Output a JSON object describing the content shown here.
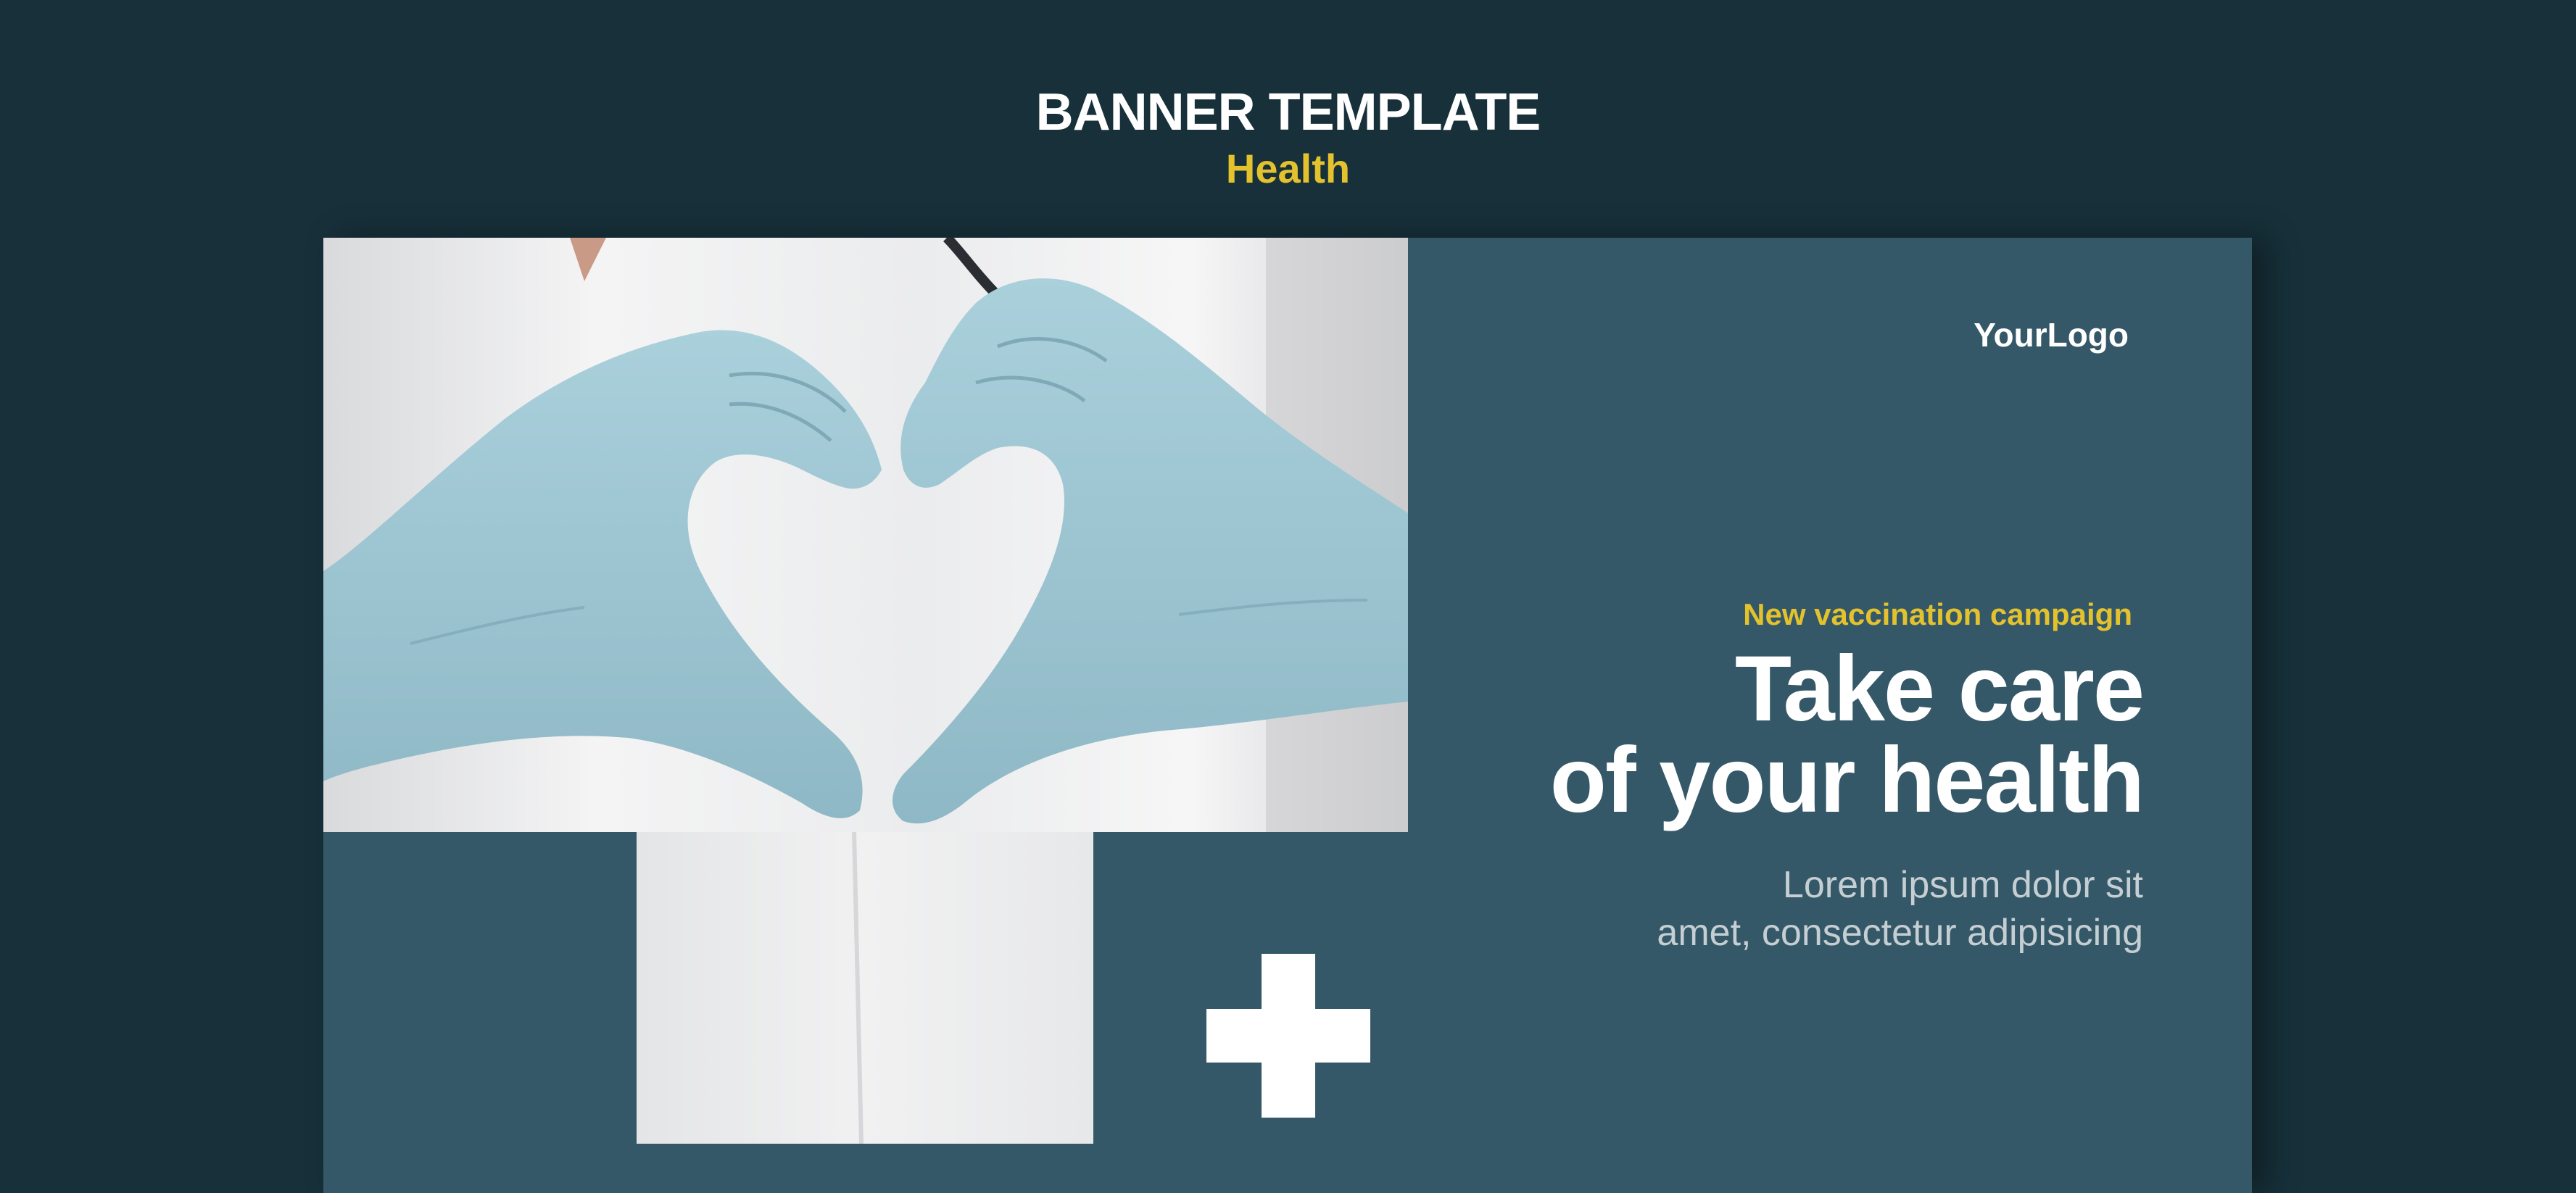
{
  "header": {
    "title": "BANNER TEMPLATE",
    "subtitle": "Health"
  },
  "banner": {
    "logo": "YourLogo",
    "tagline": "New vaccination campaign",
    "headline_lines": [
      "Take care",
      "of your health"
    ],
    "body_lines": [
      "Lorem ipsum dolor sit",
      "amet, consectetur adipisicing"
    ],
    "image_subject": "gloved-hands-heart-photo",
    "icon": "plus-icon"
  },
  "colors": {
    "page_background": "#17303a",
    "banner_background": "#355868",
    "accent": "#e3c22e",
    "glove": "#9fc6d2",
    "text": "#ffffff"
  }
}
